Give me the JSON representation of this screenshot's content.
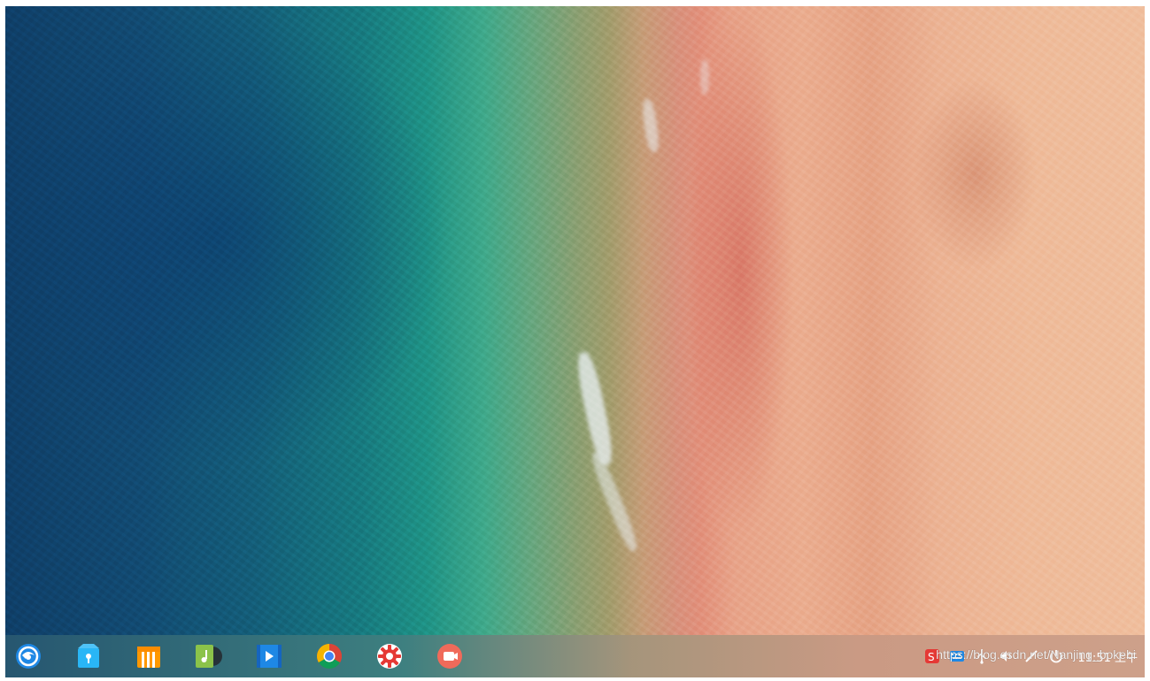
{
  "taskbar": {
    "apps": [
      {
        "name": "launcher",
        "icon": "deepin-launcher-icon",
        "color": "#1e88e5"
      },
      {
        "name": "app-store",
        "icon": "app-store-icon",
        "color": "#29b6f6"
      },
      {
        "name": "archive-manager",
        "icon": "archive-icon",
        "color": "#ff9800"
      },
      {
        "name": "music",
        "icon": "music-icon",
        "color": "#7cb342"
      },
      {
        "name": "video",
        "icon": "video-icon",
        "color": "#1e88e5"
      },
      {
        "name": "chrome",
        "icon": "chrome-icon",
        "color": "#4caf50"
      },
      {
        "name": "settings",
        "icon": "gear-icon",
        "color": "#e53935"
      },
      {
        "name": "screen-recorder",
        "icon": "record-icon",
        "color": "#f06a5a"
      }
    ],
    "tray_icons": [
      "input-method-icon",
      "keyboard-icon",
      "usb-icon",
      "volume-icon",
      "pen-icon",
      "power-icon"
    ],
    "clock": "11:51 上午"
  },
  "watermark": "https://blog.csdn.net/Nanjing_bokebi"
}
